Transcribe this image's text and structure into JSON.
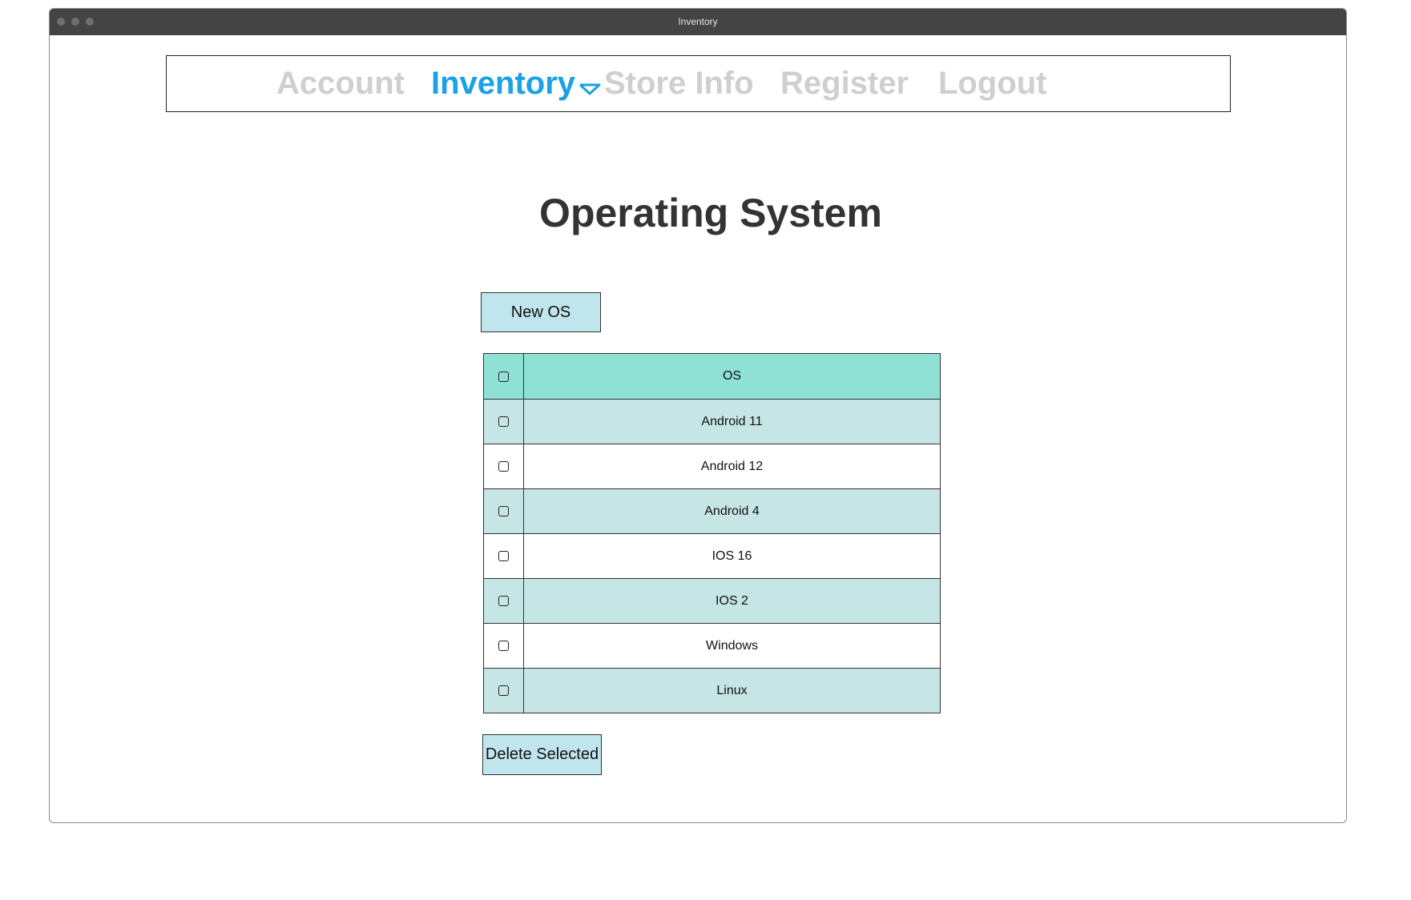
{
  "window": {
    "title": "Inventory"
  },
  "nav": {
    "items": [
      {
        "label": "Account",
        "active": false
      },
      {
        "label": "Inventory",
        "active": true
      },
      {
        "label": "Store Info",
        "active": false
      },
      {
        "label": "Register",
        "active": false
      },
      {
        "label": "Logout",
        "active": false
      }
    ],
    "active_color": "#1aa1e6",
    "inactive_color": "#cfcfcf",
    "dropdown_icon": "triangle-down-icon"
  },
  "page": {
    "title": "Operating System"
  },
  "actions": {
    "new_label": "New OS",
    "delete_label": "Delete Selected"
  },
  "table": {
    "header": "OS",
    "rows": [
      {
        "name": "Android 11",
        "checked": false
      },
      {
        "name": "Android 12",
        "checked": false
      },
      {
        "name": "Android 4",
        "checked": false
      },
      {
        "name": "IOS 16",
        "checked": false
      },
      {
        "name": "IOS 2",
        "checked": false
      },
      {
        "name": "Windows",
        "checked": false
      },
      {
        "name": "Linux",
        "checked": false
      }
    ],
    "header_color": "#8fe1d6",
    "stripe_color": "#c6e5e5"
  }
}
